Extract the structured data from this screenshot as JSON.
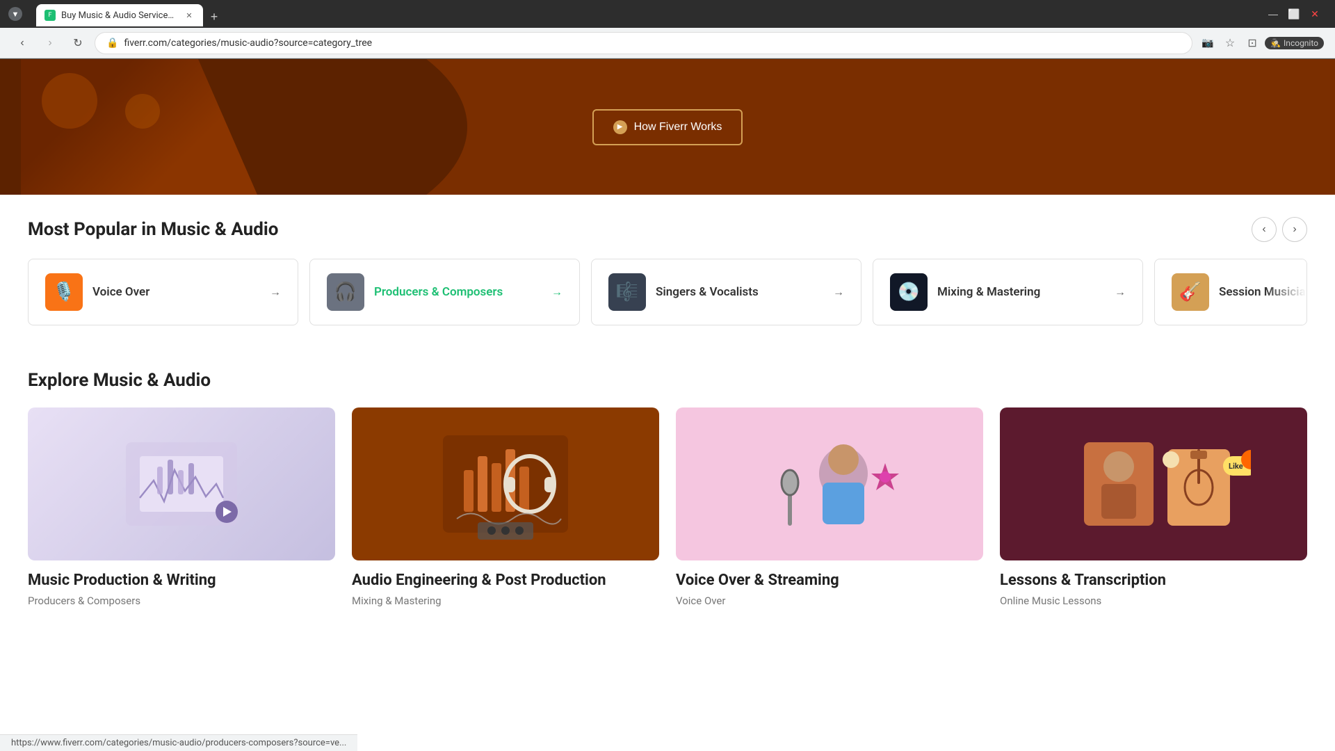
{
  "browser": {
    "tab_label": "Buy Music & Audio Services On",
    "tab_favicon": "🎵",
    "address": "fiverr.com/categories/music-audio?source=category_tree",
    "new_tab_label": "+",
    "nav_back_disabled": false,
    "nav_forward_disabled": true,
    "incognito_label": "Incognito"
  },
  "hero": {
    "how_fiverr_works_label": "How Fiverr Works"
  },
  "popular_section": {
    "title": "Most Popular in Music & Audio",
    "categories": [
      {
        "id": "voice-over",
        "label": "Voice Over",
        "icon": "🎙️",
        "icon_class": "icon-orange",
        "active": false
      },
      {
        "id": "producers-composers",
        "label": "Producers & Composers",
        "icon": "🎧",
        "icon_class": "icon-gray",
        "active": true
      },
      {
        "id": "singers-vocalists",
        "label": "Singers & Vocalists",
        "icon": "🎼",
        "icon_class": "icon-dark",
        "active": false
      },
      {
        "id": "mixing-mastering",
        "label": "Mixing & Mastering",
        "icon": "💿",
        "icon_class": "icon-black",
        "active": false
      },
      {
        "id": "session-musicians",
        "label": "Session Musicians",
        "icon": "🎸",
        "icon_class": "icon-tan",
        "active": false,
        "partial": true
      }
    ],
    "carousel_prev": "‹",
    "carousel_next": "›"
  },
  "explore_section": {
    "title": "Explore Music & Audio",
    "cards": [
      {
        "id": "music-production",
        "title": "Music Production & Writing",
        "subtitle": "Producers & Composers",
        "bg_class": "img-light-purple"
      },
      {
        "id": "audio-engineering",
        "title": "Audio Engineering & Post Production",
        "subtitle": "Mixing & Mastering",
        "bg_class": "img-rust"
      },
      {
        "id": "voice-over-streaming",
        "title": "Voice Over & Streaming",
        "subtitle": "Voice Over",
        "bg_class": "img-pink"
      },
      {
        "id": "lessons-transcription",
        "title": "Lessons & Transcription",
        "subtitle": "Online Music Lessons",
        "bg_class": "img-maroon"
      }
    ]
  },
  "status_bar": {
    "url": "https://www.fiverr.com/categories/music-audio/producers-composers?source=ve..."
  }
}
